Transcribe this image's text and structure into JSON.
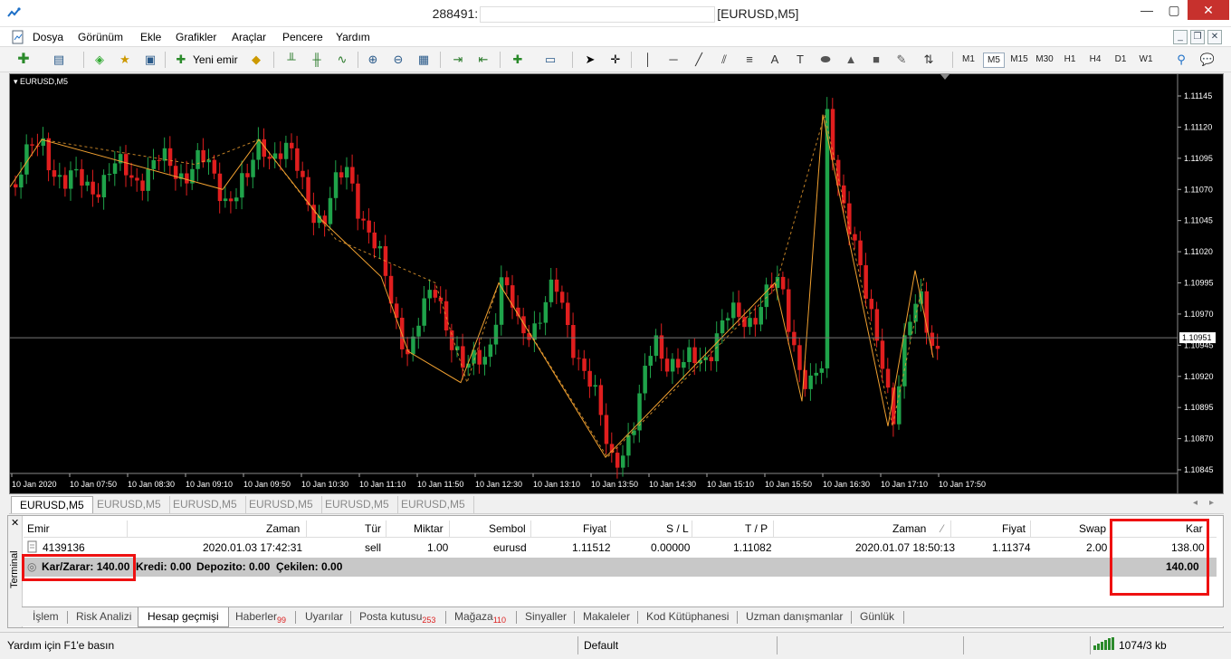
{
  "window": {
    "title_prefix": "288491:",
    "title_suffix": "[EURUSD,M5]",
    "minimize": "—",
    "maximize": "▢",
    "close": "✕"
  },
  "menu": [
    "Dosya",
    "Görünüm",
    "Ekle",
    "Grafikler",
    "Araçlar",
    "Pencere",
    "Yardım"
  ],
  "toolbar": {
    "new_order_label": "Yeni emir",
    "timeframes": [
      "M1",
      "M5",
      "M15",
      "M30",
      "H1",
      "H4",
      "D1",
      "W1"
    ],
    "active_timeframe": "M5"
  },
  "chart": {
    "label": "EURUSD,M5",
    "current_price": "1.10951",
    "price_labels": [
      "1.11145",
      "1.11120",
      "1.11095",
      "1.11070",
      "1.11045",
      "1.11020",
      "1.10995",
      "1.10970",
      "1.10945",
      "1.10920",
      "1.10895",
      "1.10870",
      "1.10845"
    ],
    "time_labels": [
      "10 Jan 2020",
      "10 Jan 07:50",
      "10 Jan 08:30",
      "10 Jan 09:10",
      "10 Jan 09:50",
      "10 Jan 10:30",
      "10 Jan 11:10",
      "10 Jan 11:50",
      "10 Jan 12:30",
      "10 Jan 13:10",
      "10 Jan 13:50",
      "10 Jan 14:30",
      "10 Jan 15:10",
      "10 Jan 15:50",
      "10 Jan 16:30",
      "10 Jan 17:10",
      "10 Jan 17:50"
    ],
    "colors": {
      "bull": "#1fa34a",
      "bear": "#e01e1e",
      "zigzag": "#f0a030",
      "background": "#000000"
    }
  },
  "chart_tabs": [
    "EURUSD,M5",
    "EURUSD,M5",
    "EURUSD,M5",
    "EURUSD,M5",
    "EURUSD,M5",
    "EURUSD,M5"
  ],
  "terminal": {
    "side_label": "Terminal",
    "headers": {
      "emir": "Emir",
      "zaman": "Zaman",
      "tur": "Tür",
      "miktar": "Miktar",
      "sembol": "Sembol",
      "fiyat": "Fiyat",
      "sl": "S / L",
      "tp": "T / P",
      "zaman2": "Zaman",
      "fiyat2": "Fiyat",
      "swap": "Swap",
      "kar": "Kar"
    },
    "row": {
      "emir": "4139136",
      "zaman": "2020.01.03 17:42:31",
      "tur": "sell",
      "miktar": "1.00",
      "sembol": "eurusd",
      "fiyat": "1.11512",
      "sl": "0.00000",
      "tp": "1.11082",
      "zaman2": "2020.01.07 18:50:13",
      "fiyat2": "1.11374",
      "swap": "2.00",
      "kar": "138.00"
    },
    "summary": {
      "karzarar": "Kar/Zarar: 140.00",
      "kredi": "Kredi: 0.00",
      "depozito": "Depozito: 0.00",
      "cekilen": "Çekilen: 0.00",
      "total": "140.00"
    }
  },
  "bottom_tabs": [
    {
      "label": "İşlem",
      "badge": ""
    },
    {
      "label": "Risk Analizi",
      "badge": ""
    },
    {
      "label": "Hesap geçmişi",
      "badge": ""
    },
    {
      "label": "Haberler",
      "badge": "99"
    },
    {
      "label": "Uyarılar",
      "badge": ""
    },
    {
      "label": "Posta kutusu",
      "badge": "253"
    },
    {
      "label": "Mağaza",
      "badge": "110"
    },
    {
      "label": "Sinyaller",
      "badge": ""
    },
    {
      "label": "Makaleler",
      "badge": ""
    },
    {
      "label": "Kod Kütüphanesi",
      "badge": ""
    },
    {
      "label": "Uzman danışmanlar",
      "badge": ""
    },
    {
      "label": "Günlük",
      "badge": ""
    }
  ],
  "status": {
    "help": "Yardım için F1'e basın",
    "profile": "Default",
    "traffic": "1074/3 kb"
  }
}
